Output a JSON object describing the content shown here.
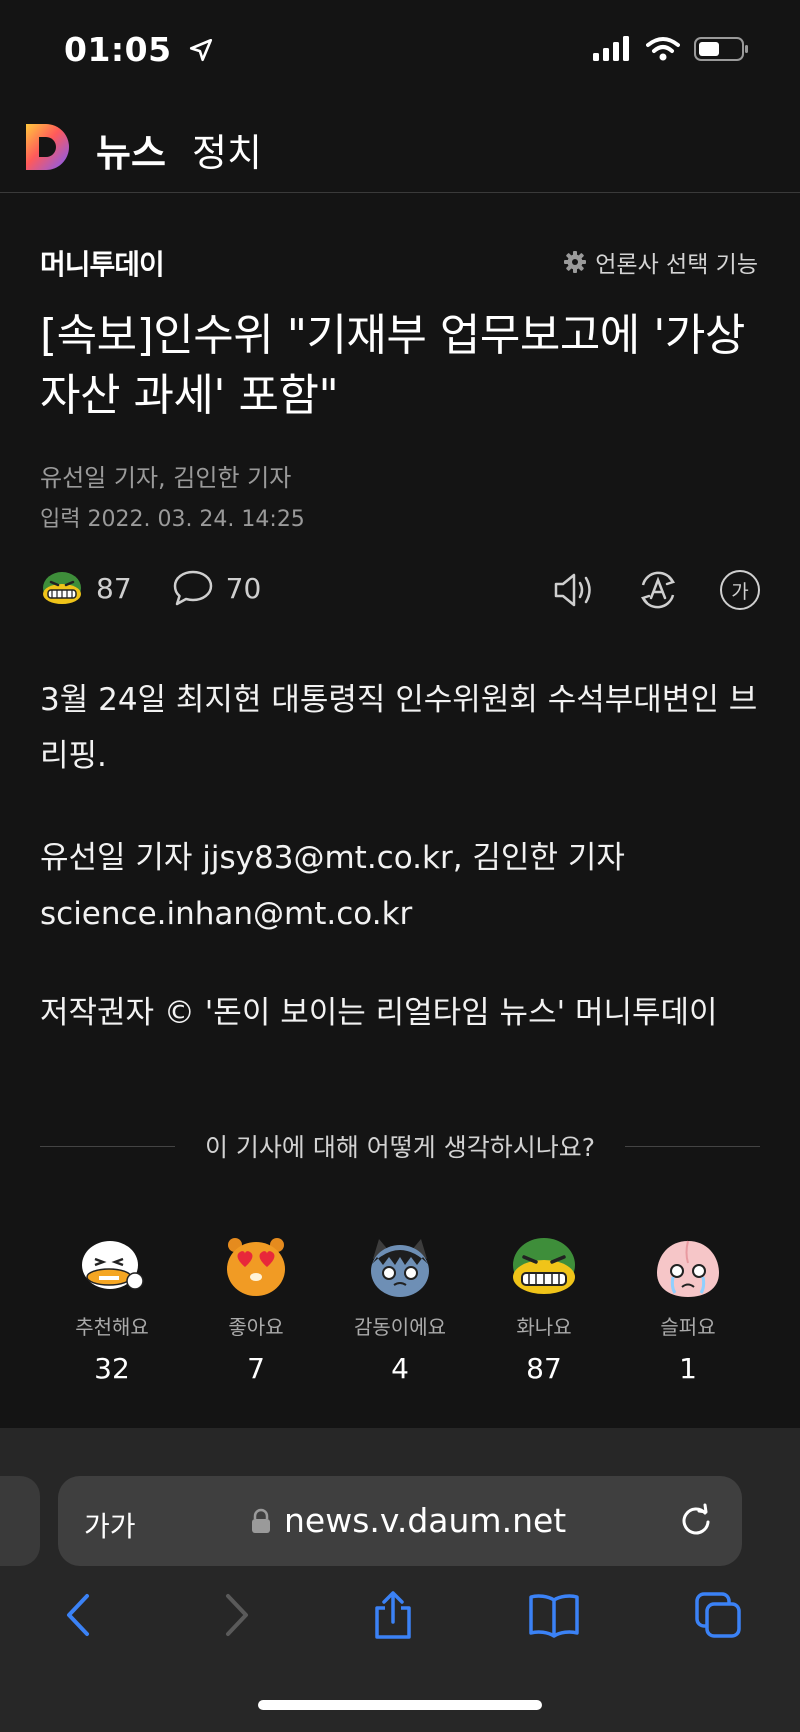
{
  "status": {
    "time": "01:05"
  },
  "header": {
    "logo_letter": "D",
    "service": "뉴스",
    "section": "정치"
  },
  "article": {
    "publisher": "머니투데이",
    "press_setting": "언론사 선택 기능",
    "headline": "[속보]인수위 \"기재부 업무보고에 '가상자산 과세' 포함\"",
    "authors": "유선일 기자, 김인한 기자",
    "input_date": "입력  2022. 03. 24. 14:25",
    "reaction_count": "87",
    "comment_count": "70",
    "font_icon_label": "가",
    "paragraphs": [
      "3월 24일 최지현 대통령직 인수위원회 수석부대변인 브리핑.",
      "유선일 기자 jjsy83@mt.co.kr, 김인한 기자 science.inhan@mt.co.kr",
      "저작권자 © '돈이 보이는 리얼타임 뉴스' 머니투데이"
    ]
  },
  "feedback": {
    "question": "이 기사에 대해 어떻게 생각하시나요?",
    "emotions": [
      {
        "label": "추천해요",
        "count": "32",
        "icon": "recommend-icon"
      },
      {
        "label": "좋아요",
        "count": "7",
        "icon": "like-icon"
      },
      {
        "label": "감동이에요",
        "count": "4",
        "icon": "touched-icon"
      },
      {
        "label": "화나요",
        "count": "87",
        "icon": "angry-icon"
      },
      {
        "label": "슬퍼요",
        "count": "1",
        "icon": "sad-icon"
      }
    ]
  },
  "browser": {
    "text_size_label": "가가",
    "url": "news.v.daum.net"
  },
  "colors": {
    "accent": "#3b82f6",
    "background": "#141414",
    "chrome": "#272727"
  }
}
